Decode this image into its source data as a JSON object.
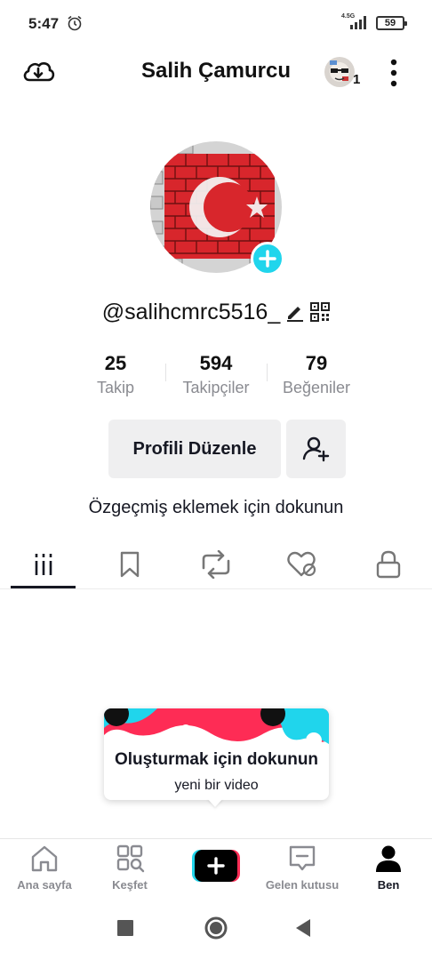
{
  "status_bar": {
    "time": "5:47",
    "network": "4.5G",
    "battery": "59"
  },
  "header": {
    "title": "Salih Çamurcu",
    "friends_count": "1"
  },
  "profile": {
    "handle": "@salihcmrc5516_",
    "stats": [
      {
        "value": "25",
        "label": "Takip"
      },
      {
        "value": "594",
        "label": "Takipçiler"
      },
      {
        "value": "79",
        "label": "Beğeniler"
      }
    ],
    "edit_button": "Profili Düzenle",
    "bio_prompt": "Özgeçmiş eklemek için dokunun"
  },
  "tabs": [
    {
      "icon": "videos-grid-icon",
      "active": true
    },
    {
      "icon": "bookmark-icon",
      "active": false
    },
    {
      "icon": "repost-icon",
      "active": false
    },
    {
      "icon": "liked-heart-icon",
      "active": false
    },
    {
      "icon": "lock-icon",
      "active": false
    }
  ],
  "tooltip": {
    "title": "Oluşturmak için dokunun",
    "subtitle": "yeni bir video"
  },
  "bottom_nav": {
    "items": [
      {
        "label": "Ana sayfa",
        "icon": "home-icon",
        "active": false
      },
      {
        "label": "Keşfet",
        "icon": "discover-icon",
        "active": false
      },
      {
        "label": "",
        "icon": "create-icon",
        "active": false
      },
      {
        "label": "Gelen kutusu",
        "icon": "inbox-icon",
        "active": false
      },
      {
        "label": "Ben",
        "icon": "profile-icon",
        "active": true
      }
    ]
  },
  "colors": {
    "accent_cyan": "#20d5ec",
    "accent_red": "#fe2c55",
    "text": "#161823",
    "muted": "#8a8b91"
  }
}
